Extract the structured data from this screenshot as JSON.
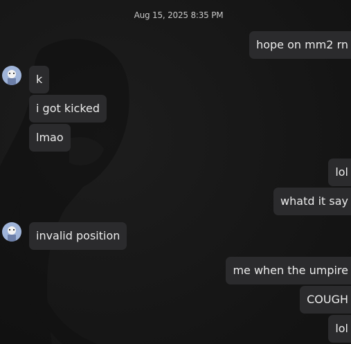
{
  "chat": {
    "timestamp": "Aug 15, 2025 8:35 PM",
    "messages": [
      {
        "id": "m1",
        "side": "out",
        "text": "hope on mm2 rn"
      },
      {
        "id": "m2",
        "side": "in",
        "text": "k",
        "avatar": true
      },
      {
        "id": "m3",
        "side": "in",
        "text": "i got kicked"
      },
      {
        "id": "m4",
        "side": "in",
        "text": "lmao"
      },
      {
        "id": "m5",
        "side": "out",
        "text": "lol"
      },
      {
        "id": "m6",
        "side": "out",
        "text": "whatd it say"
      },
      {
        "id": "m7",
        "side": "in",
        "text": "invalid position",
        "avatar": true
      },
      {
        "id": "m8",
        "side": "out",
        "text": "me when the umpire"
      },
      {
        "id": "m9",
        "side": "out",
        "text": "COUGH"
      },
      {
        "id": "m10",
        "side": "out",
        "text": "lol"
      }
    ]
  },
  "colors": {
    "background": "#161616",
    "bubble": "#2b2b2d",
    "text": "#ececec"
  }
}
